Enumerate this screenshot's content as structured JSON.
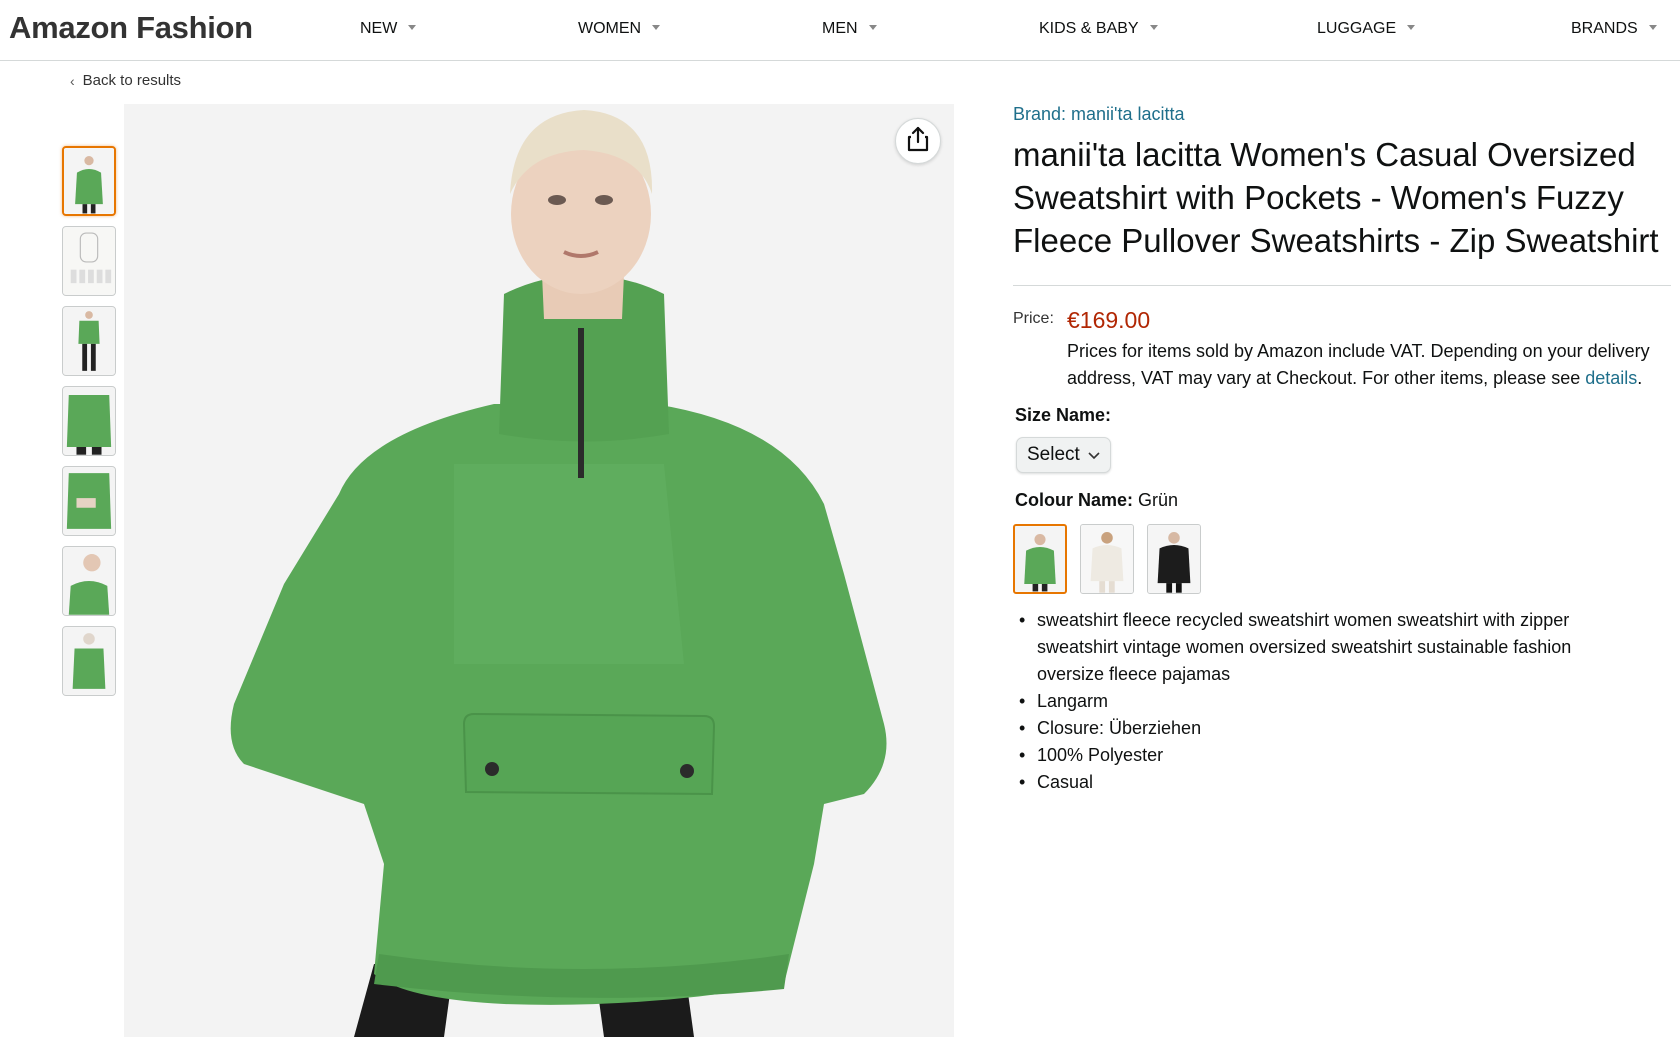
{
  "header": {
    "logo": "Amazon Fashion",
    "nav": [
      {
        "label": "NEW"
      },
      {
        "label": "WOMEN"
      },
      {
        "label": "MEN"
      },
      {
        "label": "KIDS & BABY"
      },
      {
        "label": "LUGGAGE"
      },
      {
        "label": "BRANDS"
      }
    ]
  },
  "back_link": "Back to results",
  "product": {
    "brand": "Brand: manii'ta lacitta",
    "title": "manii'ta lacitta Women's Casual Oversized Sweatshirt with Pockets - Women's Fuzzy Fleece Pullover Sweatshirts - Zip Sweatshirt",
    "price_label": "Price:",
    "price": "€169.00",
    "vat_note": "Prices for items sold by Amazon include VAT. Depending on your delivery address, VAT may vary at Checkout. For other items, please see",
    "details_link": "details",
    "details_period": ".",
    "size_label": "Size Name:",
    "size_select": "Select",
    "colour_label": "Colour Name:",
    "colour_value": "Grün",
    "bullets": [
      "sweatshirt fleece recycled sweatshirt women sweatshirt with zipper sweatshirt vintage women oversized sweatshirt sustainable fashion oversize fleece pajamas",
      "Langarm",
      "Closure: Überziehen",
      "100% Polyester",
      "Casual"
    ]
  },
  "colors": {
    "sweatshirt_green": "#5aa858",
    "price_red": "#b12704",
    "link_teal": "#1f6f8b",
    "selected_orange": "#e77600"
  },
  "icons": {
    "share": "share-icon",
    "back": "chevron-left-icon",
    "nav_caret": "caret-down-icon",
    "select_chevron": "chevron-down-icon"
  }
}
